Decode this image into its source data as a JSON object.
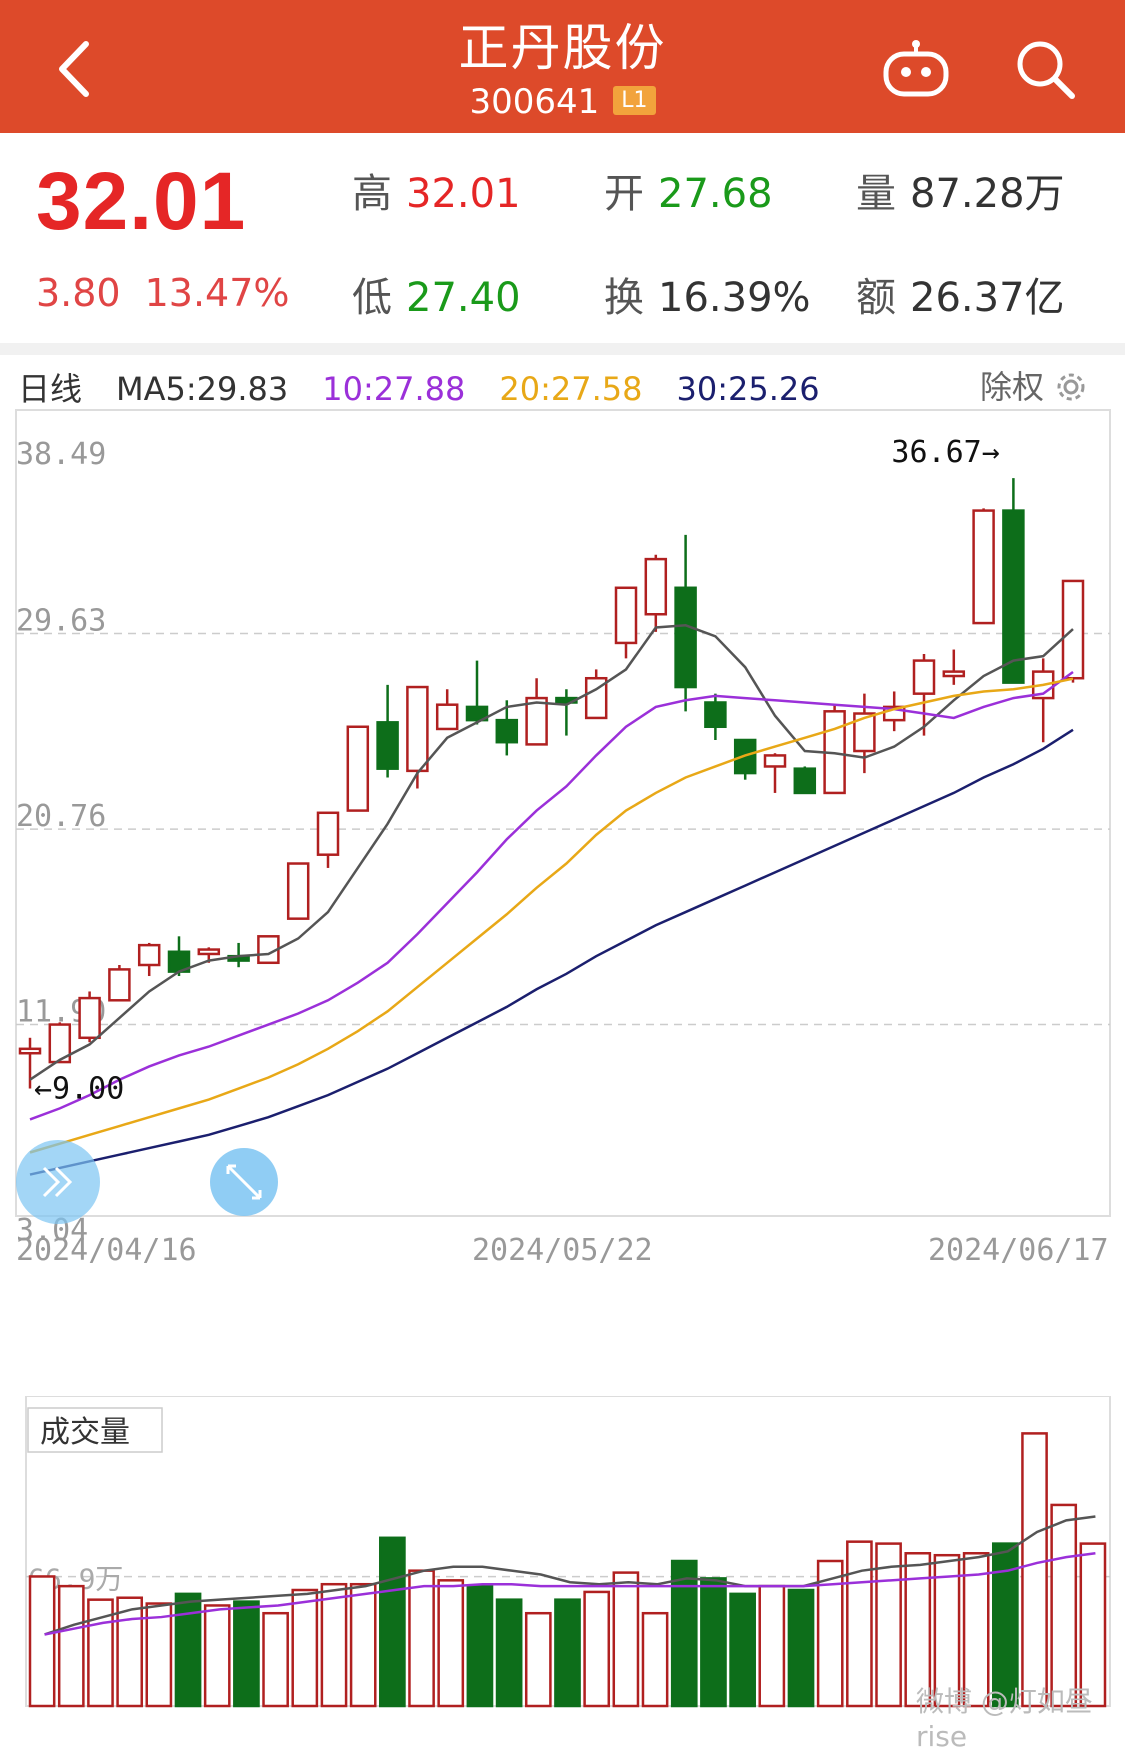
{
  "header": {
    "title": "正丹股份",
    "code": "300641",
    "badge": "L1",
    "colors": {
      "background": "#dd4a2a"
    },
    "icons": [
      "back-arrow-icon",
      "robot-icon",
      "search-icon"
    ]
  },
  "quote": {
    "price": "32.01",
    "change": "3.80",
    "change_pct": "13.47%",
    "high_label": "高",
    "high": "32.01",
    "open_label": "开",
    "open": "27.68",
    "volume_label": "量",
    "volume": "87.28万",
    "low_label": "低",
    "low": "27.40",
    "turnover_label": "换",
    "turnover": "16.39%",
    "amount_label": "额",
    "amount": "26.37亿"
  },
  "chart_legend": {
    "period": "日线",
    "ma5": "MA5:29.83",
    "ma10": "10:27.88",
    "ma20": "20:27.58",
    "ma30": "30:25.26",
    "adjust": "除权"
  },
  "price_axis": [
    "38.49",
    "29.63",
    "20.76",
    "11.90",
    "3.04"
  ],
  "date_axis": [
    "2024/04/16",
    "2024/05/22",
    "2024/06/17"
  ],
  "annotations": {
    "max": "36.67→",
    "min": "←9.00"
  },
  "volume_panel": {
    "label": "成交量",
    "axis_label": "66.9万"
  },
  "watermark": "微博 @灯如昼rise",
  "chart_data": {
    "type": "candlestick",
    "ylim": [
      3.04,
      38.49
    ],
    "candles": [
      {
        "o": 10.6,
        "c": 10.8,
        "h": 11.3,
        "l": 9.0,
        "up": true
      },
      {
        "o": 10.2,
        "c": 11.9,
        "h": 12.0,
        "l": 10.2,
        "up": true
      },
      {
        "o": 11.3,
        "c": 13.1,
        "h": 13.4,
        "l": 11.1,
        "up": true
      },
      {
        "o": 13.0,
        "c": 14.4,
        "h": 14.6,
        "l": 13.0,
        "up": true
      },
      {
        "o": 14.6,
        "c": 15.5,
        "h": 15.6,
        "l": 14.1,
        "up": true
      },
      {
        "o": 15.2,
        "c": 14.3,
        "h": 15.9,
        "l": 14.1,
        "up": false
      },
      {
        "o": 15.1,
        "c": 15.3,
        "h": 15.4,
        "l": 14.7,
        "up": true
      },
      {
        "o": 15.0,
        "c": 14.8,
        "h": 15.6,
        "l": 14.5,
        "up": false
      },
      {
        "o": 14.7,
        "c": 15.9,
        "h": 15.9,
        "l": 14.7,
        "up": true
      },
      {
        "o": 16.7,
        "c": 19.2,
        "h": 19.2,
        "l": 16.7,
        "up": true
      },
      {
        "o": 19.6,
        "c": 21.5,
        "h": 21.5,
        "l": 19.0,
        "up": true
      },
      {
        "o": 21.6,
        "c": 25.4,
        "h": 25.4,
        "l": 21.6,
        "up": true
      },
      {
        "o": 25.6,
        "c": 23.5,
        "h": 27.3,
        "l": 23.1,
        "up": false
      },
      {
        "o": 23.4,
        "c": 27.2,
        "h": 27.2,
        "l": 22.6,
        "up": true
      },
      {
        "o": 25.3,
        "c": 26.4,
        "h": 27.1,
        "l": 25.3,
        "up": true
      },
      {
        "o": 26.3,
        "c": 25.7,
        "h": 28.4,
        "l": 25.5,
        "up": false
      },
      {
        "o": 25.7,
        "c": 24.7,
        "h": 26.6,
        "l": 24.1,
        "up": false
      },
      {
        "o": 24.6,
        "c": 26.7,
        "h": 27.6,
        "l": 24.6,
        "up": true
      },
      {
        "o": 26.7,
        "c": 26.5,
        "h": 27.1,
        "l": 25.0,
        "up": false
      },
      {
        "o": 25.8,
        "c": 27.6,
        "h": 28.0,
        "l": 25.8,
        "up": true
      },
      {
        "o": 29.2,
        "c": 31.7,
        "h": 31.7,
        "l": 28.5,
        "up": true
      },
      {
        "o": 30.5,
        "c": 33.0,
        "h": 33.2,
        "l": 29.7,
        "up": true
      },
      {
        "o": 31.7,
        "c": 27.2,
        "h": 34.1,
        "l": 26.1,
        "up": false
      },
      {
        "o": 26.5,
        "c": 25.4,
        "h": 26.9,
        "l": 24.8,
        "up": false
      },
      {
        "o": 24.8,
        "c": 23.3,
        "h": 24.8,
        "l": 23.0,
        "up": false
      },
      {
        "o": 23.6,
        "c": 24.1,
        "h": 24.2,
        "l": 22.4,
        "up": true
      },
      {
        "o": 23.5,
        "c": 22.4,
        "h": 23.6,
        "l": 22.4,
        "up": false
      },
      {
        "o": 22.4,
        "c": 26.1,
        "h": 26.4,
        "l": 22.4,
        "up": true
      },
      {
        "o": 24.3,
        "c": 26.0,
        "h": 26.9,
        "l": 23.3,
        "up": true
      },
      {
        "o": 25.7,
        "c": 26.3,
        "h": 27.0,
        "l": 25.2,
        "up": true
      },
      {
        "o": 26.9,
        "c": 28.4,
        "h": 28.7,
        "l": 25.0,
        "up": true
      },
      {
        "o": 27.9,
        "c": 27.7,
        "h": 28.9,
        "l": 27.3,
        "up": true
      },
      {
        "o": 30.1,
        "c": 35.2,
        "h": 35.3,
        "l": 30.1,
        "up": true
      },
      {
        "o": 35.2,
        "c": 27.4,
        "h": 36.67,
        "l": 27.4,
        "up": false
      },
      {
        "o": 26.7,
        "c": 27.9,
        "h": 28.5,
        "l": 24.7,
        "up": true
      },
      {
        "o": 27.6,
        "c": 32.01,
        "h": 32.01,
        "l": 27.4,
        "up": true
      }
    ],
    "ma": {
      "ma5": [
        9.4,
        10.3,
        11.0,
        12.2,
        13.4,
        14.3,
        14.8,
        15.0,
        15.1,
        15.8,
        17.0,
        19.0,
        21.0,
        23.3,
        24.9,
        25.6,
        26.3,
        26.5,
        26.4,
        27.1,
        28.0,
        29.9,
        30.0,
        29.5,
        28.1,
        25.9,
        24.3,
        24.2,
        24.0,
        24.5,
        25.4,
        26.6,
        27.7,
        28.4,
        28.6,
        29.83
      ],
      "ma10": [
        7.6,
        8.1,
        8.7,
        9.4,
        10.0,
        10.5,
        10.9,
        11.4,
        11.9,
        12.4,
        13.0,
        13.8,
        14.7,
        16.0,
        17.4,
        18.8,
        20.3,
        21.6,
        22.7,
        24.1,
        25.4,
        26.3,
        26.6,
        26.8,
        26.7,
        26.6,
        26.5,
        26.4,
        26.3,
        26.2,
        26.0,
        25.8,
        26.3,
        26.7,
        26.9,
        27.88
      ],
      "ma20": [
        6.1,
        6.5,
        6.9,
        7.3,
        7.7,
        8.1,
        8.5,
        9.0,
        9.5,
        10.1,
        10.8,
        11.6,
        12.5,
        13.6,
        14.7,
        15.8,
        16.9,
        18.1,
        19.2,
        20.5,
        21.6,
        22.4,
        23.1,
        23.6,
        24.1,
        24.5,
        24.9,
        25.3,
        25.8,
        26.2,
        26.5,
        26.8,
        27.0,
        27.1,
        27.3,
        27.58
      ],
      "ma30": [
        5.1,
        5.4,
        5.7,
        6.0,
        6.3,
        6.6,
        6.9,
        7.3,
        7.7,
        8.2,
        8.7,
        9.3,
        9.9,
        10.6,
        11.3,
        12.0,
        12.7,
        13.5,
        14.2,
        15.0,
        15.7,
        16.4,
        17.0,
        17.6,
        18.2,
        18.8,
        19.4,
        20.0,
        20.6,
        21.2,
        21.8,
        22.4,
        23.1,
        23.7,
        24.4,
        25.26
      ]
    },
    "volume": {
      "unit": "万",
      "ylim": [
        0,
        150
      ],
      "bars": [
        67,
        62,
        55,
        56,
        53,
        58,
        52,
        54,
        48,
        60,
        63,
        63,
        87,
        70,
        65,
        62,
        55,
        48,
        55,
        59,
        69,
        48,
        75,
        66,
        58,
        62,
        60,
        75,
        85,
        84,
        79,
        78,
        79,
        84,
        141,
        104,
        84
      ],
      "ma": [
        37,
        42,
        46,
        50,
        52,
        54,
        55,
        56,
        57,
        58,
        60,
        62,
        66,
        70,
        72,
        72,
        70,
        68,
        64,
        63,
        64,
        63,
        66,
        65,
        62,
        62,
        62,
        66,
        70,
        72,
        73,
        75,
        77,
        80,
        90,
        96,
        98
      ],
      "ma2": [
        37,
        40,
        43,
        45,
        46,
        48,
        50,
        51,
        52,
        54,
        56,
        58,
        60,
        62,
        62,
        63,
        63,
        62,
        62,
        62,
        62,
        62,
        62,
        62,
        62,
        62,
        62,
        63,
        64,
        65,
        66,
        67,
        68,
        70,
        74,
        77,
        79
      ]
    }
  }
}
